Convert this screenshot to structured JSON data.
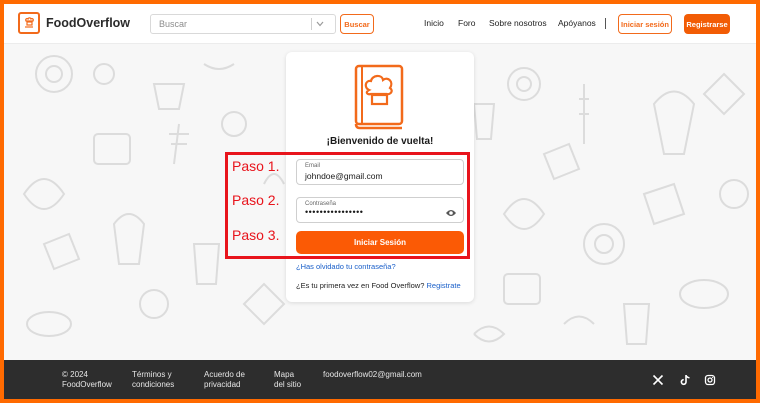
{
  "header": {
    "brand": "FoodOverflow",
    "search_placeholder": "Buscar",
    "search_button": "Buscar",
    "nav": [
      "Inicio",
      "Foro",
      "Sobre nosotros",
      "Apóyanos"
    ],
    "login_button": "Iniciar sesión",
    "register_button": "Registrarse"
  },
  "login": {
    "welcome": "¡Bienvenido de vuelta!",
    "email_label": "Email",
    "email_value": "johndoe@gmail.com",
    "password_label": "Contraseña",
    "password_value": "••••••••••••••••",
    "submit": "Iniciar Sesión",
    "forgot": "¿Has olvidado tu contraseña?",
    "first_time": "¿Es tu primera vez en Food Overflow?",
    "register_link": "Registrate"
  },
  "annotation": {
    "steps": [
      "Paso 1.",
      "Paso 2.",
      "Paso 3."
    ]
  },
  "footer": {
    "copyright_line1": "© 2024",
    "copyright_line2": "FoodOverflow",
    "terms_line1": "Términos y",
    "terms_line2": "condiciones",
    "privacy_line1": "Acuerdo de",
    "privacy_line2": "privacidad",
    "sitemap_line1": "Mapa",
    "sitemap_line2": "del sitio",
    "email": "foodoverflow02@gmail.com",
    "social_icons": [
      "x-icon",
      "tiktok-icon",
      "instagram-icon"
    ]
  },
  "colors": {
    "accent": "#f26a1b",
    "annotation": "#e8141c",
    "footer_bg": "#2d2d2d",
    "link": "#1a5fc9"
  }
}
